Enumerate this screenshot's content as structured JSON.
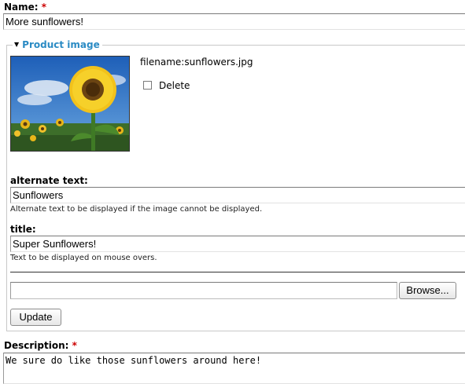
{
  "name_field": {
    "label": "Name:",
    "required_mark": "*",
    "value": "More sunflowers!"
  },
  "product_image": {
    "legend": "Product image",
    "filename_text": "filename:sunflowers.jpg",
    "delete_label": "Delete",
    "delete_checked": false,
    "alt_text": {
      "label": "alternate text:",
      "value": "Sunflowers",
      "help": "Alternate text to be displayed if the image cannot be displayed."
    },
    "title": {
      "label": "title:",
      "value": "Super Sunflowers!",
      "help": "Text to be displayed on mouse overs."
    },
    "file_input": {
      "value": "",
      "browse_label": "Browse..."
    },
    "update_label": "Update"
  },
  "description_field": {
    "label": "Description:",
    "required_mark": "*",
    "value": "We sure do like those sunflowers around here!"
  },
  "colors": {
    "legend_blue": "#2b8bc4",
    "required_red": "#cc0000"
  }
}
